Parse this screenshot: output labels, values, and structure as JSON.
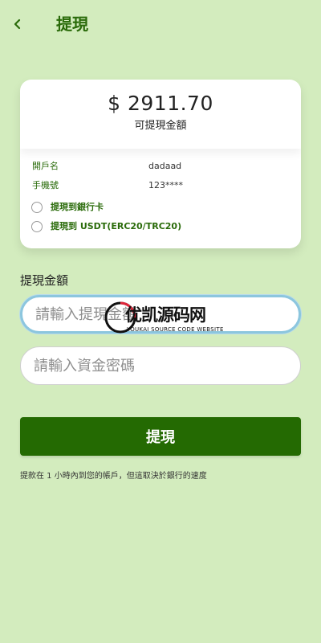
{
  "header": {
    "title": "提現",
    "back_icon": "chevron-left-icon"
  },
  "balance": {
    "currency_symbol": "$",
    "amount": "2911.70",
    "label": "可提現金額"
  },
  "account": {
    "name_label": "開戶名",
    "name_value": "dadaad",
    "phone_label": "手機號",
    "phone_value": "123****"
  },
  "methods": [
    {
      "label": "提現到銀行卡",
      "selected": false
    },
    {
      "label": "提現到 USDT(ERC20/TRC20)",
      "selected": false
    }
  ],
  "form": {
    "amount_section_label": "提現金額",
    "amount_placeholder": "請輸入提現金額",
    "password_placeholder": "請輸入資金密碼"
  },
  "watermark": {
    "text": "优凯源码网",
    "subtext": "YOUKAI SOURCE CODE WEBSITE"
  },
  "submit": {
    "label": "提現"
  },
  "note": "提款在 1 小時內到您的帳戶，但這取決於銀行的速度",
  "colors": {
    "background": "#d3ecbe",
    "accent": "#246a02",
    "accent_text": "#2a6b0a",
    "focus_border": "#8cc6de"
  }
}
